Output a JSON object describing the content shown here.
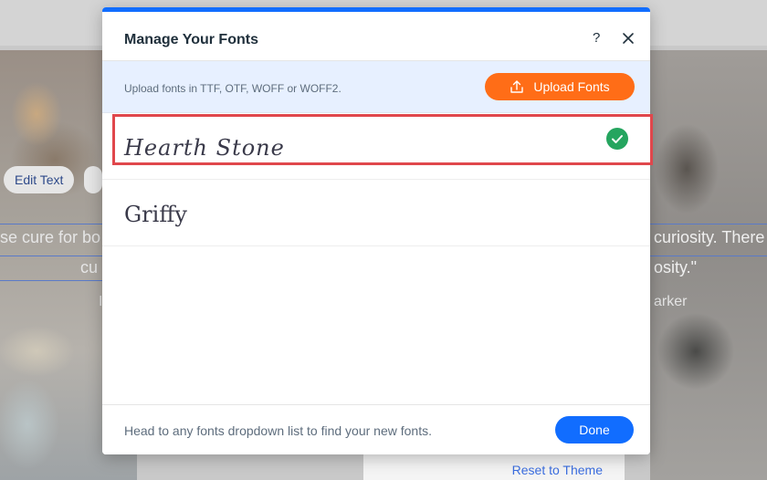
{
  "modal": {
    "title": "Manage Your Fonts",
    "help_label": "?",
    "close_label": "✕",
    "upload_hint": "Upload fonts in TTF, OTF, WOFF or WOFF2.",
    "upload_button_label": "Upload Fonts",
    "fonts": [
      {
        "name": "Hearth Stone",
        "status": "uploaded"
      },
      {
        "name": "Griffy"
      }
    ],
    "footer_hint": "Head to any fonts dropdown list to find your new fonts.",
    "done_label": "Done"
  },
  "background": {
    "edit_text_label": "Edit Text",
    "quote_left_line1": "se cure for bo",
    "quote_left_line2": "cu",
    "quote_right_line1": "curiosity. There",
    "quote_right_line2": "osity.\"",
    "author_right": "arker",
    "author_left": "I",
    "reset_label": "Reset to Theme"
  },
  "colors": {
    "accent": "#116dff",
    "upload_button": "#ff6d17",
    "success": "#25a55f",
    "highlight": "#e0474c"
  },
  "icons": {
    "upload": "upload-icon",
    "check": "check-circle-icon",
    "close": "close-icon",
    "help": "help-icon"
  }
}
